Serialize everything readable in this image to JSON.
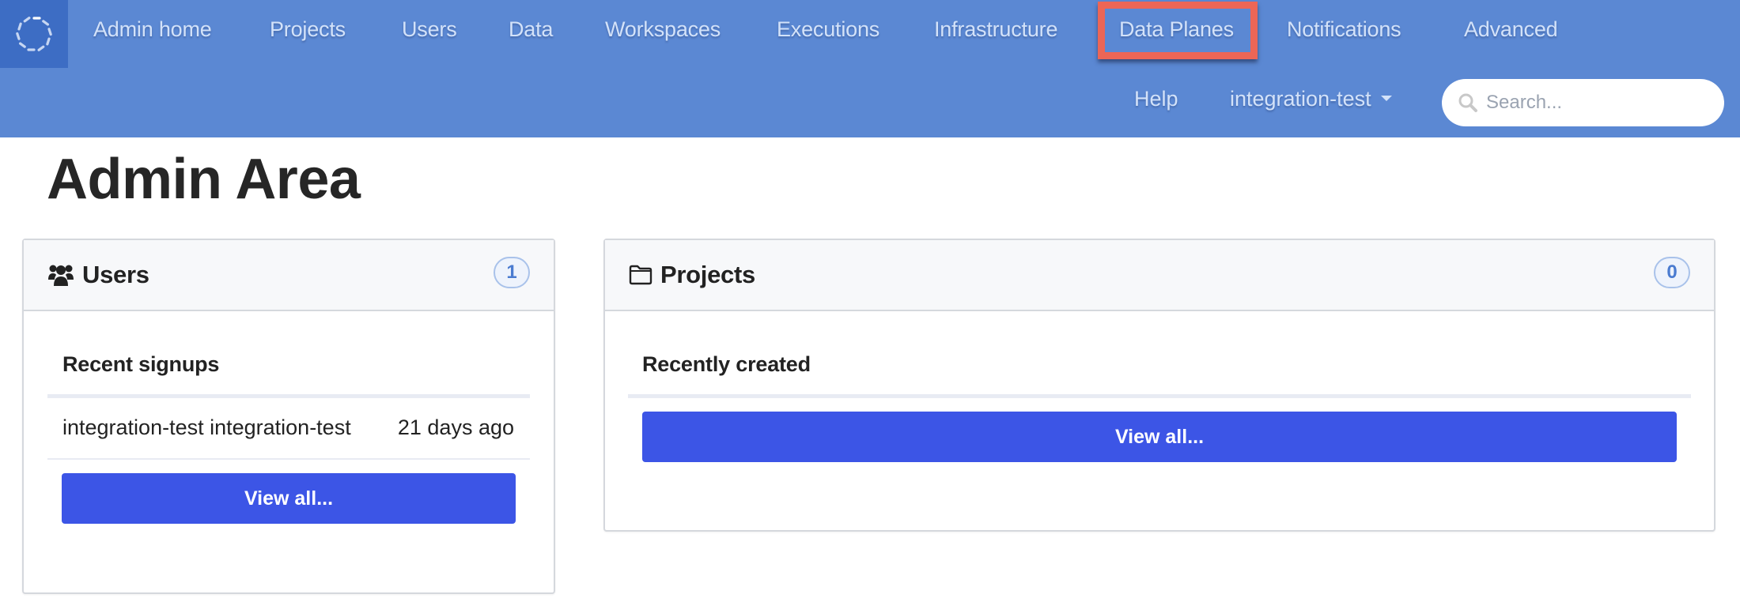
{
  "nav": {
    "logo": "spinner-logo-icon",
    "items": [
      {
        "label": "Admin home"
      },
      {
        "label": "Projects"
      },
      {
        "label": "Users"
      },
      {
        "label": "Data"
      },
      {
        "label": "Workspaces"
      },
      {
        "label": "Executions"
      },
      {
        "label": "Infrastructure"
      },
      {
        "label": "Data Planes",
        "highlighted": true
      },
      {
        "label": "Notifications"
      },
      {
        "label": "Advanced"
      }
    ],
    "help_label": "Help",
    "user_menu_label": "integration-test",
    "search_placeholder": "Search...",
    "highlight_color": "#ec6656",
    "bar_color": "#5b88d3"
  },
  "page": {
    "title": "Admin Area"
  },
  "users_card": {
    "title": "Users",
    "icon": "users-icon",
    "count": "1",
    "section_title": "Recent signups",
    "rows": [
      {
        "name": "integration-test integration-test",
        "when": "21 days ago"
      }
    ],
    "view_all_label": "View all..."
  },
  "projects_card": {
    "title": "Projects",
    "icon": "folder-icon",
    "count": "0",
    "section_title": "Recently created",
    "rows": [],
    "view_all_label": "View all..."
  },
  "colors": {
    "button": "#3c55e6",
    "badge_text": "#4a7bd0"
  }
}
